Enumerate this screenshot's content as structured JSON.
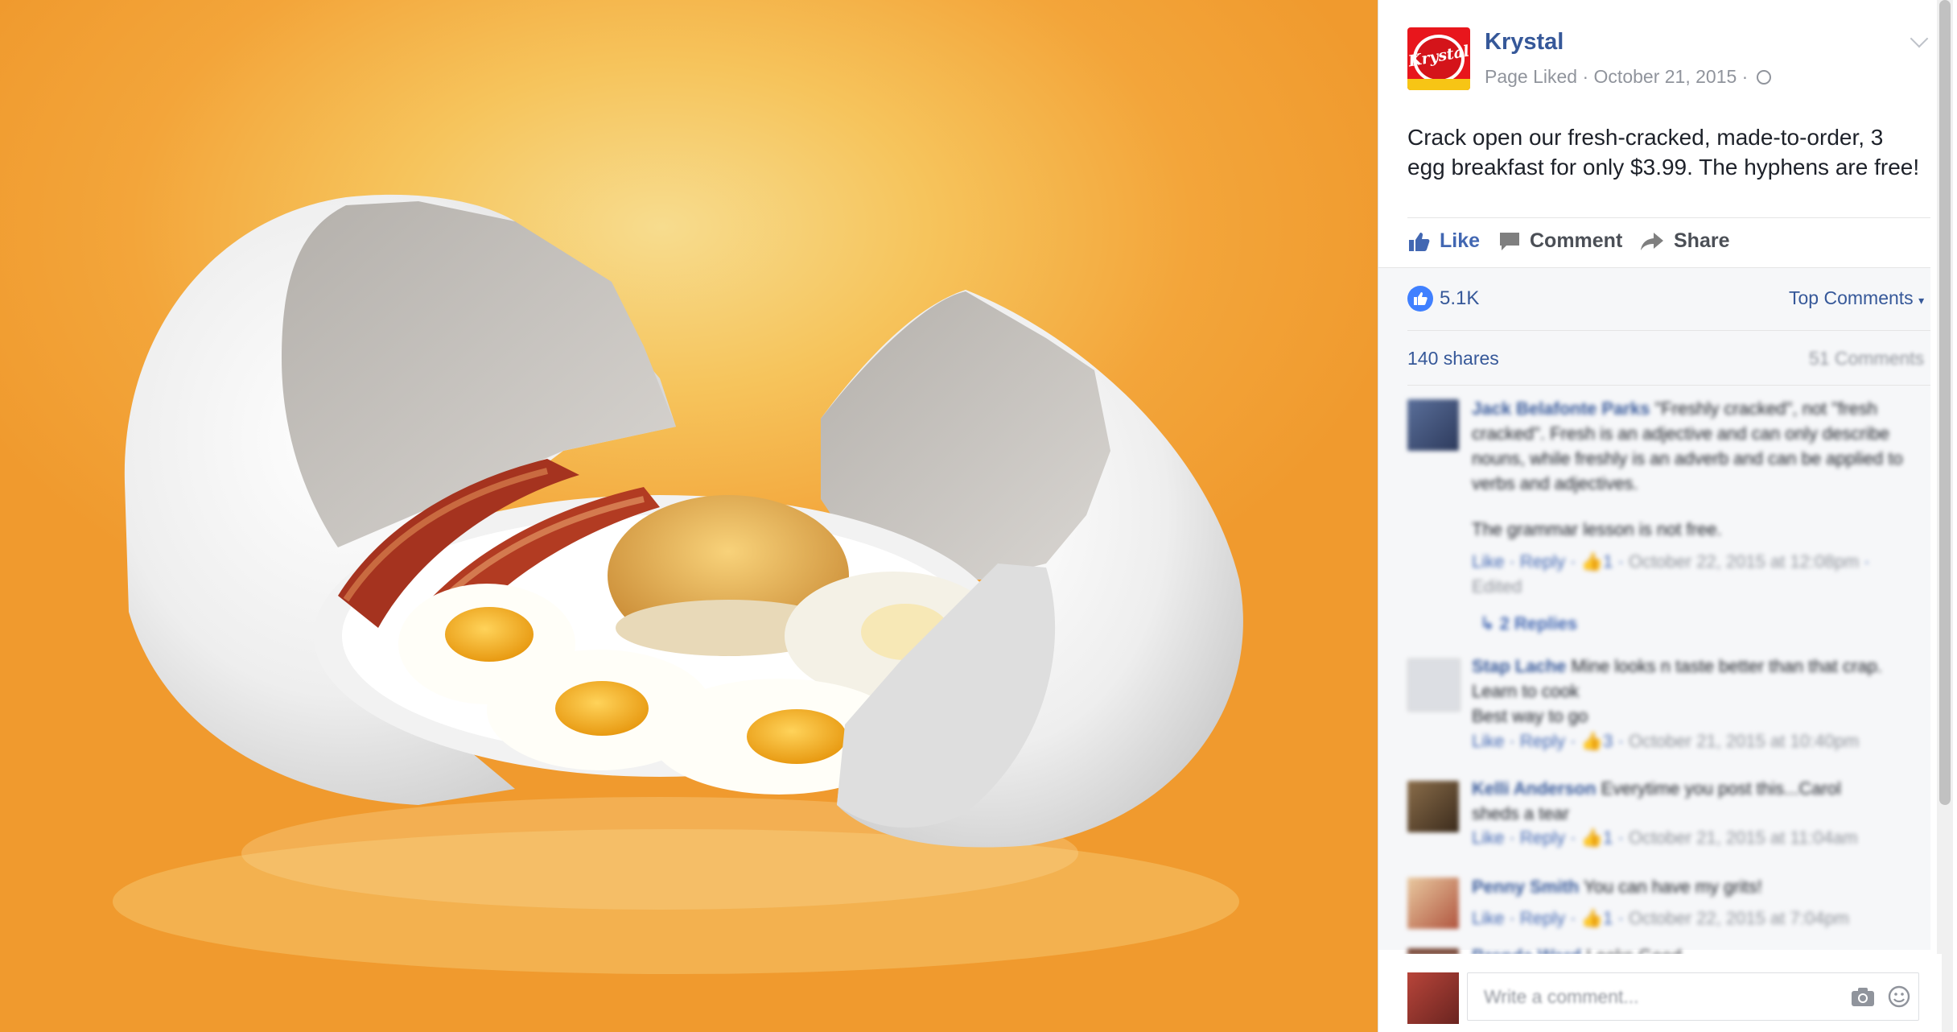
{
  "post": {
    "page_name": "Krystal",
    "logo_text": "Krystal",
    "status": "Page Liked",
    "date": "October 21, 2015",
    "text": "Crack open our fresh-cracked, made-to-order, 3 egg breakfast for only $3.99. The hyphens are free!"
  },
  "actions": {
    "like": "Like",
    "comment": "Comment",
    "share": "Share"
  },
  "stats": {
    "likes": "5.1K",
    "sort": "Top Comments",
    "shares": "140 shares",
    "comments": "51 Comments"
  },
  "comments": [
    {
      "name": "Jack Belafonte Parks",
      "text": "\"Freshly cracked\", not \"fresh cracked\". Fresh is an adjective and can only describe nouns, while freshly is an adverb and can be applied to verbs and adjectives.",
      "text2": "The grammar lesson is not free.",
      "like": "Like",
      "reply": "Reply",
      "count": "1",
      "time": "October 22, 2015 at 12:08pm",
      "edited": "Edited",
      "replies": "2 Replies"
    },
    {
      "name": "Stap Lache",
      "text": "Mine looks n taste better than that crap. Learn to cook",
      "text2": "Best way to go",
      "like": "Like",
      "reply": "Reply",
      "count": "3",
      "time": "October 21, 2015 at 10:40pm"
    },
    {
      "name": "Kelli Anderson",
      "text": "Everytime you post this...Carol sheds a tear",
      "like": "Like",
      "reply": "Reply",
      "count": "1",
      "time": "October 21, 2015 at 11:04am"
    },
    {
      "name": "Penny Smith",
      "text": "You can have my grits!",
      "like": "Like",
      "reply": "Reply",
      "count": "1",
      "time": "October 22, 2015 at 7:04pm"
    },
    {
      "name": "Brenda Ward",
      "text": "Looks Good"
    }
  ],
  "composer": {
    "placeholder": "Write a comment..."
  },
  "icons": [
    "chevron-down-icon",
    "globe-icon",
    "thumbs-up-icon",
    "comment-icon",
    "share-icon",
    "camera-icon",
    "emoji-icon",
    "reply-arrow-icon"
  ],
  "colors": {
    "link": "#365899",
    "accent": "#4080ff",
    "background": "#f09a2e"
  }
}
